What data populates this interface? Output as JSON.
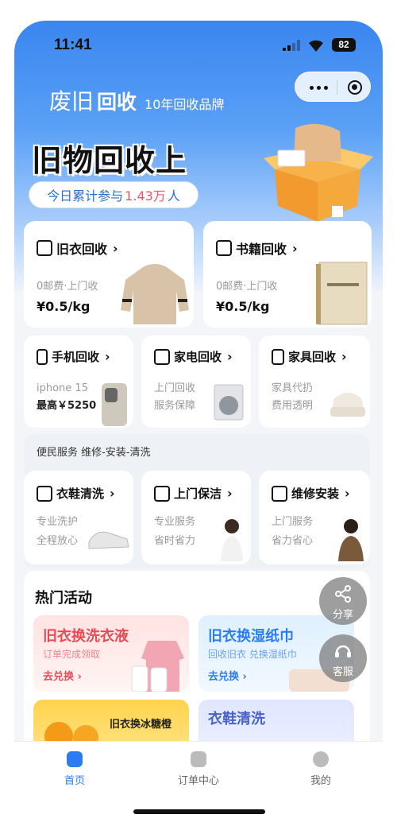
{
  "status": {
    "time": "11:41",
    "battery": "82"
  },
  "header": {
    "brand_prefix": "废旧",
    "brand_main": "回收",
    "brand_tag": "10年回收品牌",
    "hero": "旧物回收上",
    "participants_prefix": "今日累计参与",
    "participants_count": "1.43万",
    "participants_suffix": "人"
  },
  "big_cards": [
    {
      "title": "旧衣回收",
      "arrow": "›",
      "sub": "0邮费·上门收",
      "price": "¥0.5",
      "unit": "/kg"
    },
    {
      "title": "书籍回收",
      "arrow": "›",
      "sub": "0邮费·上门收",
      "price": "¥0.5",
      "unit": "/kg"
    }
  ],
  "small_cards": [
    {
      "title": "手机回收",
      "arrow": "›",
      "line1": "iphone 15",
      "line2": "最高￥5250"
    },
    {
      "title": "家电回收",
      "arrow": "›",
      "line1": "上门回收",
      "line2": "服务保障"
    },
    {
      "title": "家具回收",
      "arrow": "›",
      "line1": "家具代扔",
      "line2": "费用透明"
    }
  ],
  "services": {
    "header": "便民服务 维修-安装-清洗",
    "items": [
      {
        "title": "衣鞋清洗",
        "arrow": "›",
        "line1": "专业洗护",
        "line2": "全程放心"
      },
      {
        "title": "上门保洁",
        "arrow": "›",
        "line1": "专业服务",
        "line2": "省时省力"
      },
      {
        "title": "维修安装",
        "arrow": "›",
        "line1": "上门服务",
        "line2": "省力省心"
      }
    ]
  },
  "activities": {
    "header": "热门活动",
    "promos": [
      {
        "title": "旧衣换洗衣液",
        "sub": "订单完成领取",
        "btn": "去兑换 ›"
      },
      {
        "title": "旧衣换湿纸巾",
        "sub": "回收旧衣 兑换湿纸巾",
        "btn": "去兑换 ›"
      },
      {
        "title": "旧衣换冰糖橙",
        "sub": "",
        "btn": ""
      },
      {
        "title": "衣鞋清洗",
        "sub": "",
        "btn": ""
      }
    ]
  },
  "floating": {
    "share": "分享",
    "service": "客服"
  },
  "tabs": [
    {
      "label": "首页"
    },
    {
      "label": "订单中心"
    },
    {
      "label": "我的"
    }
  ],
  "colors": {
    "accent": "#2a7cf0",
    "highlight": "#e8556b"
  }
}
